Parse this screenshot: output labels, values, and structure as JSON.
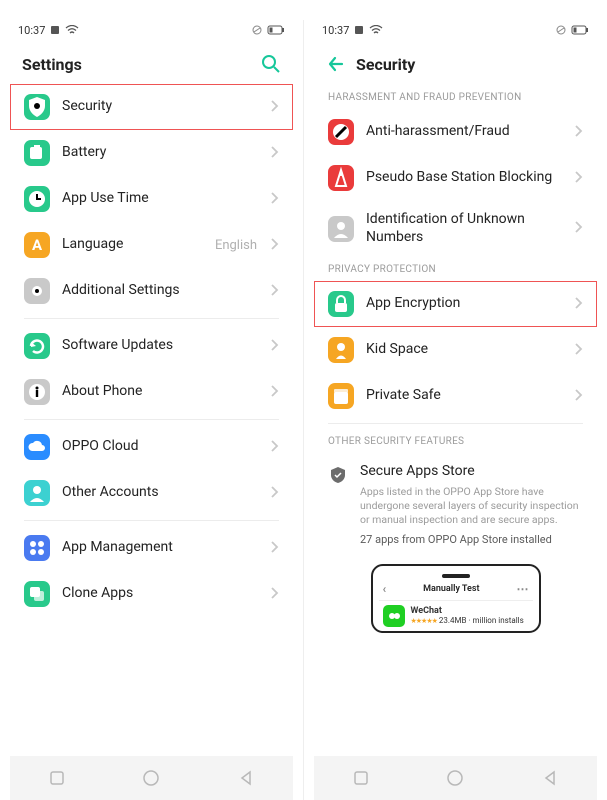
{
  "status": {
    "time": "10:37"
  },
  "left": {
    "title": "Settings",
    "items": [
      {
        "name": "security",
        "label": "Security",
        "icon": "shield",
        "color": "ic-green",
        "highlight": true
      },
      {
        "name": "battery",
        "label": "Battery",
        "icon": "battery",
        "color": "ic-green2"
      },
      {
        "name": "apptime",
        "label": "App Use Time",
        "icon": "clock",
        "color": "ic-green2"
      },
      {
        "name": "language",
        "label": "Language",
        "icon": "a",
        "color": "ic-orange",
        "value": "English"
      },
      {
        "name": "additional",
        "label": "Additional Settings",
        "icon": "gear",
        "color": "ic-gray"
      }
    ],
    "items2": [
      {
        "name": "updates",
        "label": "Software Updates",
        "icon": "refresh",
        "color": "ic-green2"
      },
      {
        "name": "about",
        "label": "About Phone",
        "icon": "info",
        "color": "ic-gray"
      }
    ],
    "items3": [
      {
        "name": "cloud",
        "label": "OPPO Cloud",
        "icon": "cloud",
        "color": "ic-blue"
      },
      {
        "name": "accts",
        "label": "Other Accounts",
        "icon": "person",
        "color": "ic-cyan"
      }
    ],
    "items4": [
      {
        "name": "appmgmt",
        "label": "App Management",
        "icon": "grid",
        "color": "ic-blu2"
      },
      {
        "name": "clone",
        "label": "Clone Apps",
        "icon": "copy",
        "color": "ic-green2"
      }
    ]
  },
  "right": {
    "title": "Security",
    "section1": "HARASSMENT AND FRAUD PREVENTION",
    "s1items": [
      {
        "name": "antiharass",
        "label": "Anti-harassment/Fraud",
        "icon": "block",
        "color": "ic-red"
      },
      {
        "name": "pseudo",
        "label": "Pseudo Base Station Blocking",
        "icon": "tower",
        "color": "ic-red"
      },
      {
        "name": "unknown",
        "label": "Identification of Unknown Numbers",
        "icon": "person",
        "color": "ic-gray"
      }
    ],
    "section2": "PRIVACY PROTECTION",
    "s2items": [
      {
        "name": "appenc",
        "label": "App Encryption",
        "icon": "lock",
        "color": "ic-green2",
        "highlight": true
      },
      {
        "name": "kidspace",
        "label": "Kid Space",
        "icon": "child",
        "color": "ic-orange"
      },
      {
        "name": "private",
        "label": "Private Safe",
        "icon": "box",
        "color": "ic-orange"
      }
    ],
    "section3": "OTHER SECURITY FEATURES",
    "secure": {
      "title": "Secure Apps Store",
      "desc": "Apps listed in the OPPO App Store have undergone several layers of security inspection or manual inspection and are secure apps.",
      "count": "27 apps from OPPO App Store installed"
    },
    "mock": {
      "title": "Manually Test",
      "app": "WeChat",
      "sub": "23.4MB · million installs"
    }
  }
}
